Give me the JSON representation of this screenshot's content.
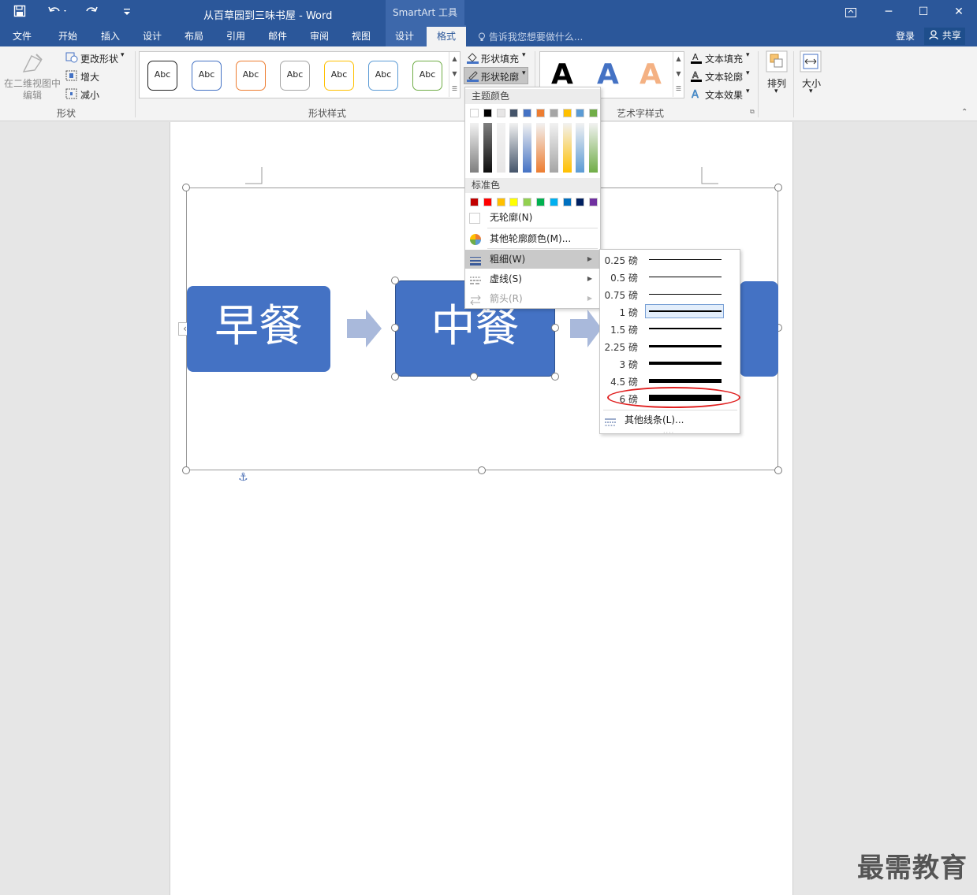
{
  "window": {
    "doc_title": "从百草园到三味书屋 - Word",
    "context_title": "SmartArt 工具",
    "minimize": "─",
    "maximize": "☐",
    "close": "✕"
  },
  "tabs": {
    "file": "文件",
    "home": "开始",
    "insert": "插入",
    "design": "设计",
    "layout": "布局",
    "references": "引用",
    "mailings": "邮件",
    "review": "审阅",
    "view": "视图",
    "sa_design": "设计",
    "sa_format": "格式",
    "tell_me": "告诉我您想要做什么...",
    "login": "登录",
    "share": "共享"
  },
  "ribbon": {
    "shapes": {
      "edit_in_2d": "在二维视图中编辑",
      "change_shape": "更改形状",
      "larger": "增大",
      "smaller": "减小",
      "label": "形状"
    },
    "shape_styles": {
      "gallery": [
        "Abc",
        "Abc",
        "Abc",
        "Abc",
        "Abc",
        "Abc",
        "Abc"
      ],
      "gallery_colors": [
        "#222222",
        "#4472c4",
        "#ed7d31",
        "#a5a5a5",
        "#ffc000",
        "#5b9bd5",
        "#70ad47"
      ],
      "fill": "形状填充",
      "outline": "形状轮廓",
      "label": "形状样式"
    },
    "wordart": {
      "letters": [
        "A",
        "A",
        "A"
      ],
      "text_fill": "文本填充",
      "text_outline": "文本轮廓",
      "text_effects": "文本效果",
      "label": "艺术字样式"
    },
    "arrange": "排列",
    "size": "大小"
  },
  "smartart": {
    "shape1": "早餐",
    "shape2": "中餐",
    "fill_color": "#4472c4",
    "arrow_color": "#a9b9db"
  },
  "outline_menu": {
    "theme_colors_header": "主题颜色",
    "theme_colors": [
      "#ffffff",
      "#000000",
      "#e7e6e6",
      "#44546a",
      "#4472c4",
      "#ed7d31",
      "#a5a5a5",
      "#ffc000",
      "#5b9bd5",
      "#70ad47"
    ],
    "standard_colors_header": "标准色",
    "standard_colors": [
      "#c00000",
      "#ff0000",
      "#ffc000",
      "#ffff00",
      "#92d050",
      "#00b050",
      "#00b0f0",
      "#0070c0",
      "#002060",
      "#7030a0"
    ],
    "no_outline": "无轮廓(N)",
    "more_colors": "其他轮廓颜色(M)...",
    "weight": "粗细(W)",
    "dashes": "虚线(S)",
    "arrows": "箭头(R)"
  },
  "weight_menu": {
    "items": [
      "0.25 磅",
      "0.5 磅",
      "0.75 磅",
      "1 磅",
      "1.5 磅",
      "2.25 磅",
      "3 磅",
      "4.5 磅",
      "6 磅"
    ],
    "selected": "1 磅",
    "highlighted": "6 磅",
    "more_lines": "其他线条(L)..."
  },
  "watermark": "最需教育"
}
